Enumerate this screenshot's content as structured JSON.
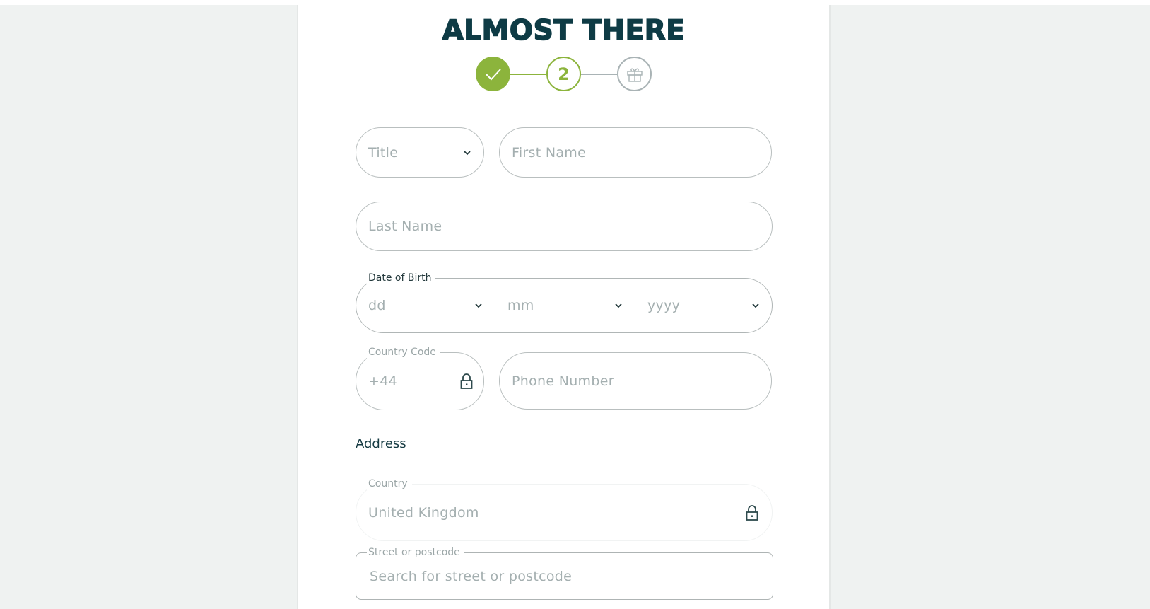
{
  "page": {
    "heading": "ALMOST THERE",
    "colors": {
      "accent": "#8cb43c",
      "heading": "#0e3b45",
      "muted": "#a9b3b5"
    }
  },
  "stepper": {
    "steps": [
      {
        "state": "completed",
        "icon": "check-icon",
        "label": ""
      },
      {
        "state": "current",
        "icon": "",
        "label": "2"
      },
      {
        "state": "upcoming",
        "icon": "gift-icon",
        "label": ""
      }
    ]
  },
  "form": {
    "title": {
      "placeholder": "Title",
      "icon": "chevron-down-icon"
    },
    "first_name": {
      "placeholder": "First Name",
      "value": ""
    },
    "last_name": {
      "placeholder": "Last Name",
      "value": ""
    },
    "date_of_birth": {
      "label": "Date of Birth",
      "day": {
        "placeholder": "dd"
      },
      "month": {
        "placeholder": "mm"
      },
      "year": {
        "placeholder": "yyyy"
      }
    },
    "country_code": {
      "label": "Country Code",
      "value": "+44",
      "locked": true,
      "icon": "lock-icon"
    },
    "phone_number": {
      "placeholder": "Phone Number",
      "value": ""
    },
    "address": {
      "section_label": "Address",
      "country": {
        "label": "Country",
        "value": "United Kingdom",
        "locked": true,
        "icon": "lock-icon"
      },
      "street": {
        "label": "Street or postcode",
        "placeholder": "Search for street or postcode",
        "value": ""
      }
    }
  }
}
